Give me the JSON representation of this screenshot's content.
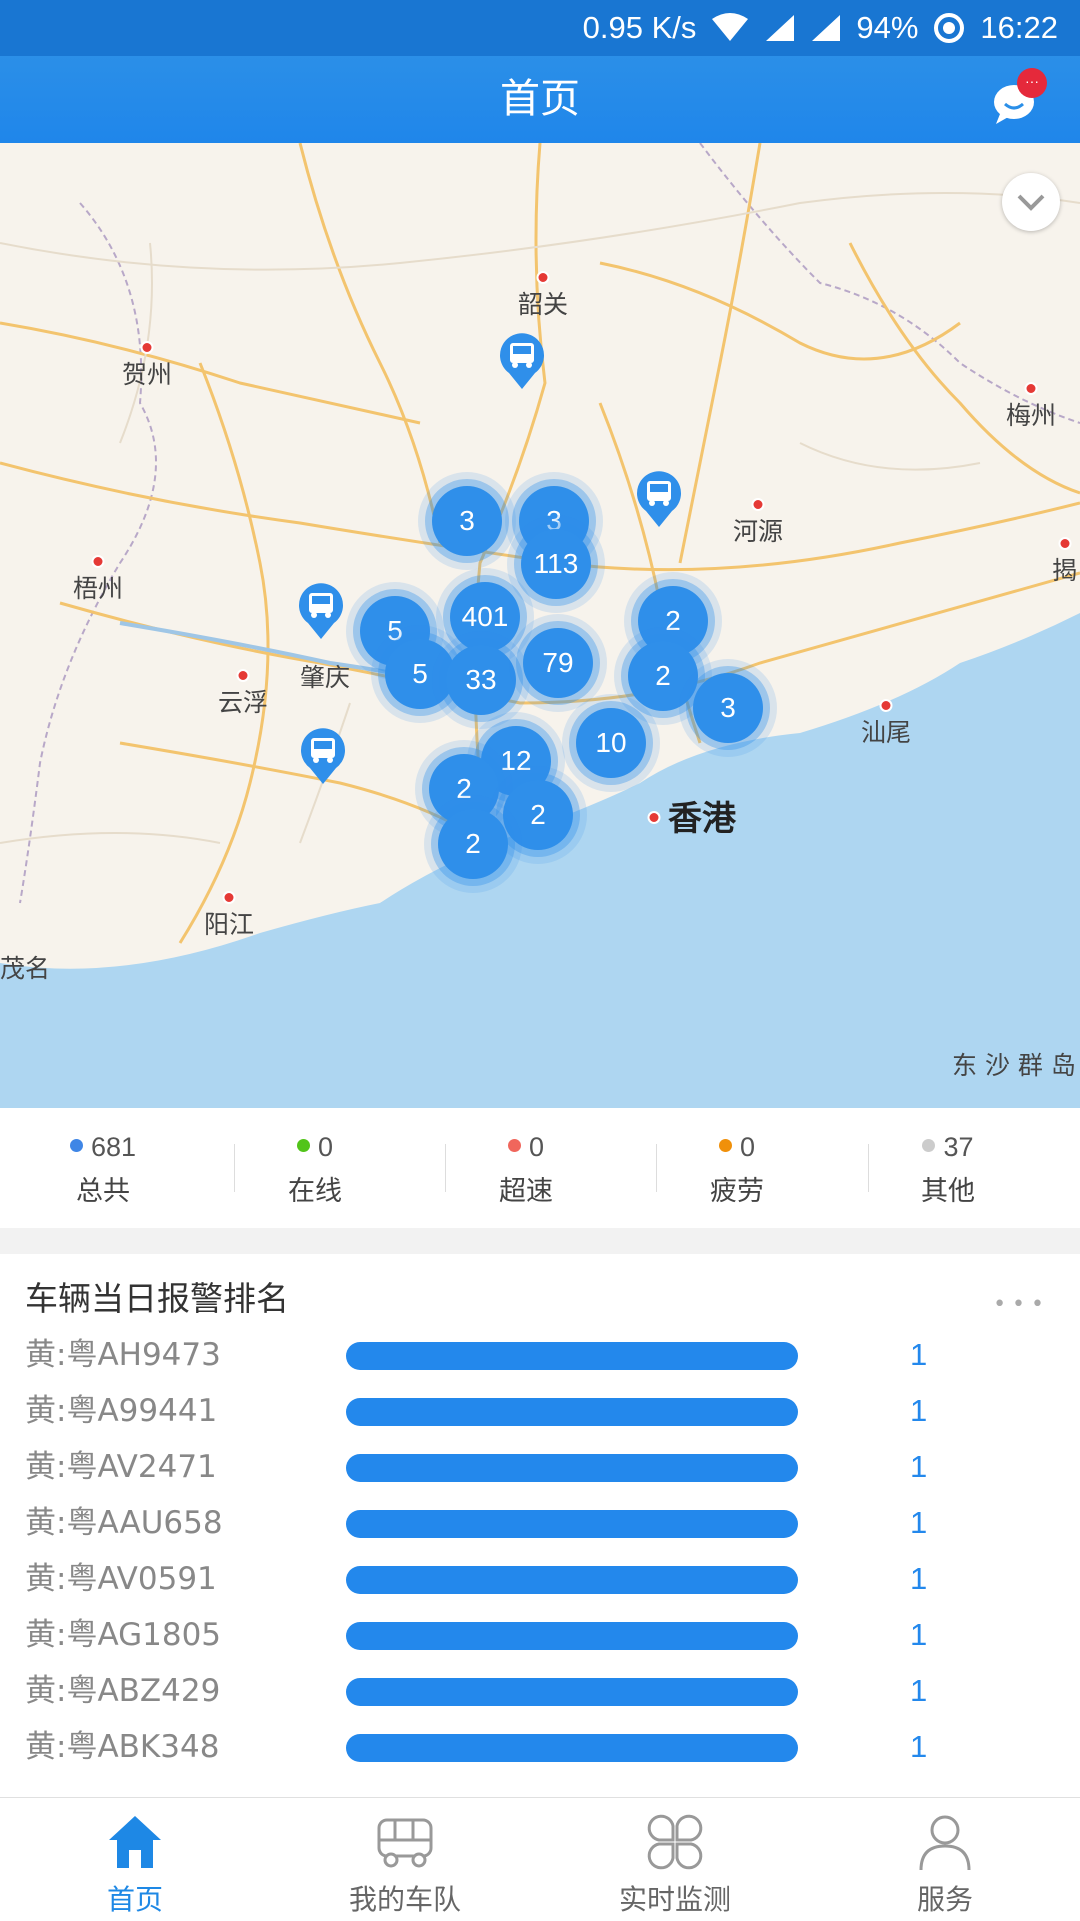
{
  "status_bar": {
    "speed": "0.95 K/s",
    "battery": "94%",
    "time": "16:22"
  },
  "header": {
    "title": "首页",
    "chat_badge": "···"
  },
  "map": {
    "cities": [
      {
        "name": "韶关"
      },
      {
        "name": "贺州"
      },
      {
        "name": "梅州"
      },
      {
        "name": "河源"
      },
      {
        "name": "梧州"
      },
      {
        "name": "揭"
      },
      {
        "name": "肇庆"
      },
      {
        "name": "云浮"
      },
      {
        "name": "汕尾"
      },
      {
        "name": "阳江"
      },
      {
        "name": "茂名"
      },
      {
        "name": "香港"
      },
      {
        "name": "东 沙 群 岛"
      }
    ],
    "clusters": [
      "3",
      "3",
      "113",
      "401",
      "5",
      "5",
      "33",
      "79",
      "2",
      "2",
      "3",
      "10",
      "12",
      "2",
      "2",
      "2"
    ]
  },
  "stats": [
    {
      "value": "681",
      "label": "总共",
      "color": "#3f86e6"
    },
    {
      "value": "0",
      "label": "在线",
      "color": "#52c41a"
    },
    {
      "value": "0",
      "label": "超速",
      "color": "#f0665c"
    },
    {
      "value": "0",
      "label": "疲劳",
      "color": "#f0900a"
    },
    {
      "value": "37",
      "label": "其他",
      "color": "#cccccc"
    }
  ],
  "ranking": {
    "title": "车辆当日报警排名",
    "more": "•••",
    "rows": [
      {
        "plate": "黄:粤AH9473",
        "count": "1",
        "fraction": 1.0
      },
      {
        "plate": "黄:粤A99441",
        "count": "1",
        "fraction": 1.0
      },
      {
        "plate": "黄:粤AV2471",
        "count": "1",
        "fraction": 1.0
      },
      {
        "plate": "黄:粤AAU658",
        "count": "1",
        "fraction": 1.0
      },
      {
        "plate": "黄:粤AV0591",
        "count": "1",
        "fraction": 1.0
      },
      {
        "plate": "黄:粤AG1805",
        "count": "1",
        "fraction": 1.0
      },
      {
        "plate": "黄:粤ABZ429",
        "count": "1",
        "fraction": 1.0
      },
      {
        "plate": "黄:粤ABK348",
        "count": "1",
        "fraction": 1.0
      }
    ]
  },
  "tabs": [
    {
      "label": "首页",
      "icon": "home-icon",
      "active": true
    },
    {
      "label": "我的车队",
      "icon": "bus-icon",
      "active": false
    },
    {
      "label": "实时监测",
      "icon": "grid-icon",
      "active": false
    },
    {
      "label": "服务",
      "icon": "user-icon",
      "active": false
    }
  ],
  "colors": {
    "primary": "#1f86ea",
    "status_bar": "#1976d2",
    "bar": "#2388ec"
  }
}
